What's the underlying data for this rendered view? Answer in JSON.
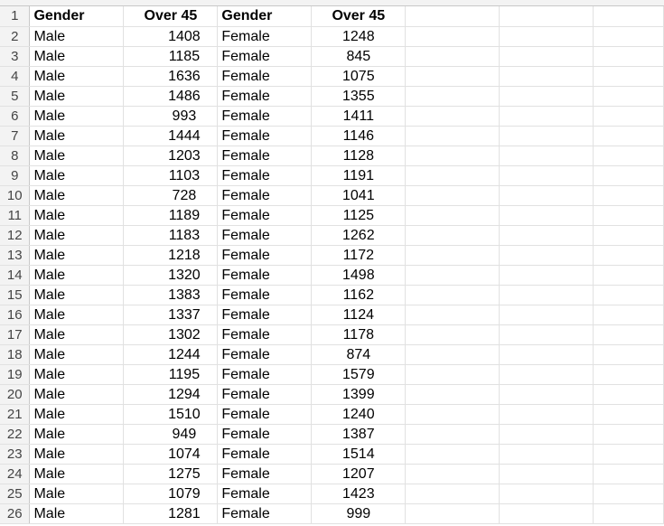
{
  "headers": [
    "Gender",
    "Over 45",
    "Gender",
    "Over 45"
  ],
  "rows": [
    {
      "n": "2",
      "a": "Male",
      "b": "1408",
      "c": "Female",
      "d": "1248"
    },
    {
      "n": "3",
      "a": "Male",
      "b": "1185",
      "c": "Female",
      "d": "845"
    },
    {
      "n": "4",
      "a": "Male",
      "b": "1636",
      "c": "Female",
      "d": "1075"
    },
    {
      "n": "5",
      "a": "Male",
      "b": "1486",
      "c": "Female",
      "d": "1355"
    },
    {
      "n": "6",
      "a": "Male",
      "b": "993",
      "c": "Female",
      "d": "1411"
    },
    {
      "n": "7",
      "a": "Male",
      "b": "1444",
      "c": "Female",
      "d": "1146"
    },
    {
      "n": "8",
      "a": "Male",
      "b": "1203",
      "c": "Female",
      "d": "1128"
    },
    {
      "n": "9",
      "a": "Male",
      "b": "1103",
      "c": "Female",
      "d": "1191"
    },
    {
      "n": "10",
      "a": "Male",
      "b": "728",
      "c": "Female",
      "d": "1041"
    },
    {
      "n": "11",
      "a": "Male",
      "b": "1189",
      "c": "Female",
      "d": "1125"
    },
    {
      "n": "12",
      "a": "Male",
      "b": "1183",
      "c": "Female",
      "d": "1262"
    },
    {
      "n": "13",
      "a": "Male",
      "b": "1218",
      "c": "Female",
      "d": "1172"
    },
    {
      "n": "14",
      "a": "Male",
      "b": "1320",
      "c": "Female",
      "d": "1498"
    },
    {
      "n": "15",
      "a": "Male",
      "b": "1383",
      "c": "Female",
      "d": "1162"
    },
    {
      "n": "16",
      "a": "Male",
      "b": "1337",
      "c": "Female",
      "d": "1124"
    },
    {
      "n": "17",
      "a": "Male",
      "b": "1302",
      "c": "Female",
      "d": "1178"
    },
    {
      "n": "18",
      "a": "Male",
      "b": "1244",
      "c": "Female",
      "d": "874"
    },
    {
      "n": "19",
      "a": "Male",
      "b": "1195",
      "c": "Female",
      "d": "1579"
    },
    {
      "n": "20",
      "a": "Male",
      "b": "1294",
      "c": "Female",
      "d": "1399"
    },
    {
      "n": "21",
      "a": "Male",
      "b": "1510",
      "c": "Female",
      "d": "1240"
    },
    {
      "n": "22",
      "a": "Male",
      "b": "949",
      "c": "Female",
      "d": "1387"
    },
    {
      "n": "23",
      "a": "Male",
      "b": "1074",
      "c": "Female",
      "d": "1514"
    },
    {
      "n": "24",
      "a": "Male",
      "b": "1275",
      "c": "Female",
      "d": "1207"
    },
    {
      "n": "25",
      "a": "Male",
      "b": "1079",
      "c": "Female",
      "d": "1423"
    },
    {
      "n": "26",
      "a": "Male",
      "b": "1281",
      "c": "Female",
      "d": "999"
    }
  ],
  "header_row_number": "1"
}
